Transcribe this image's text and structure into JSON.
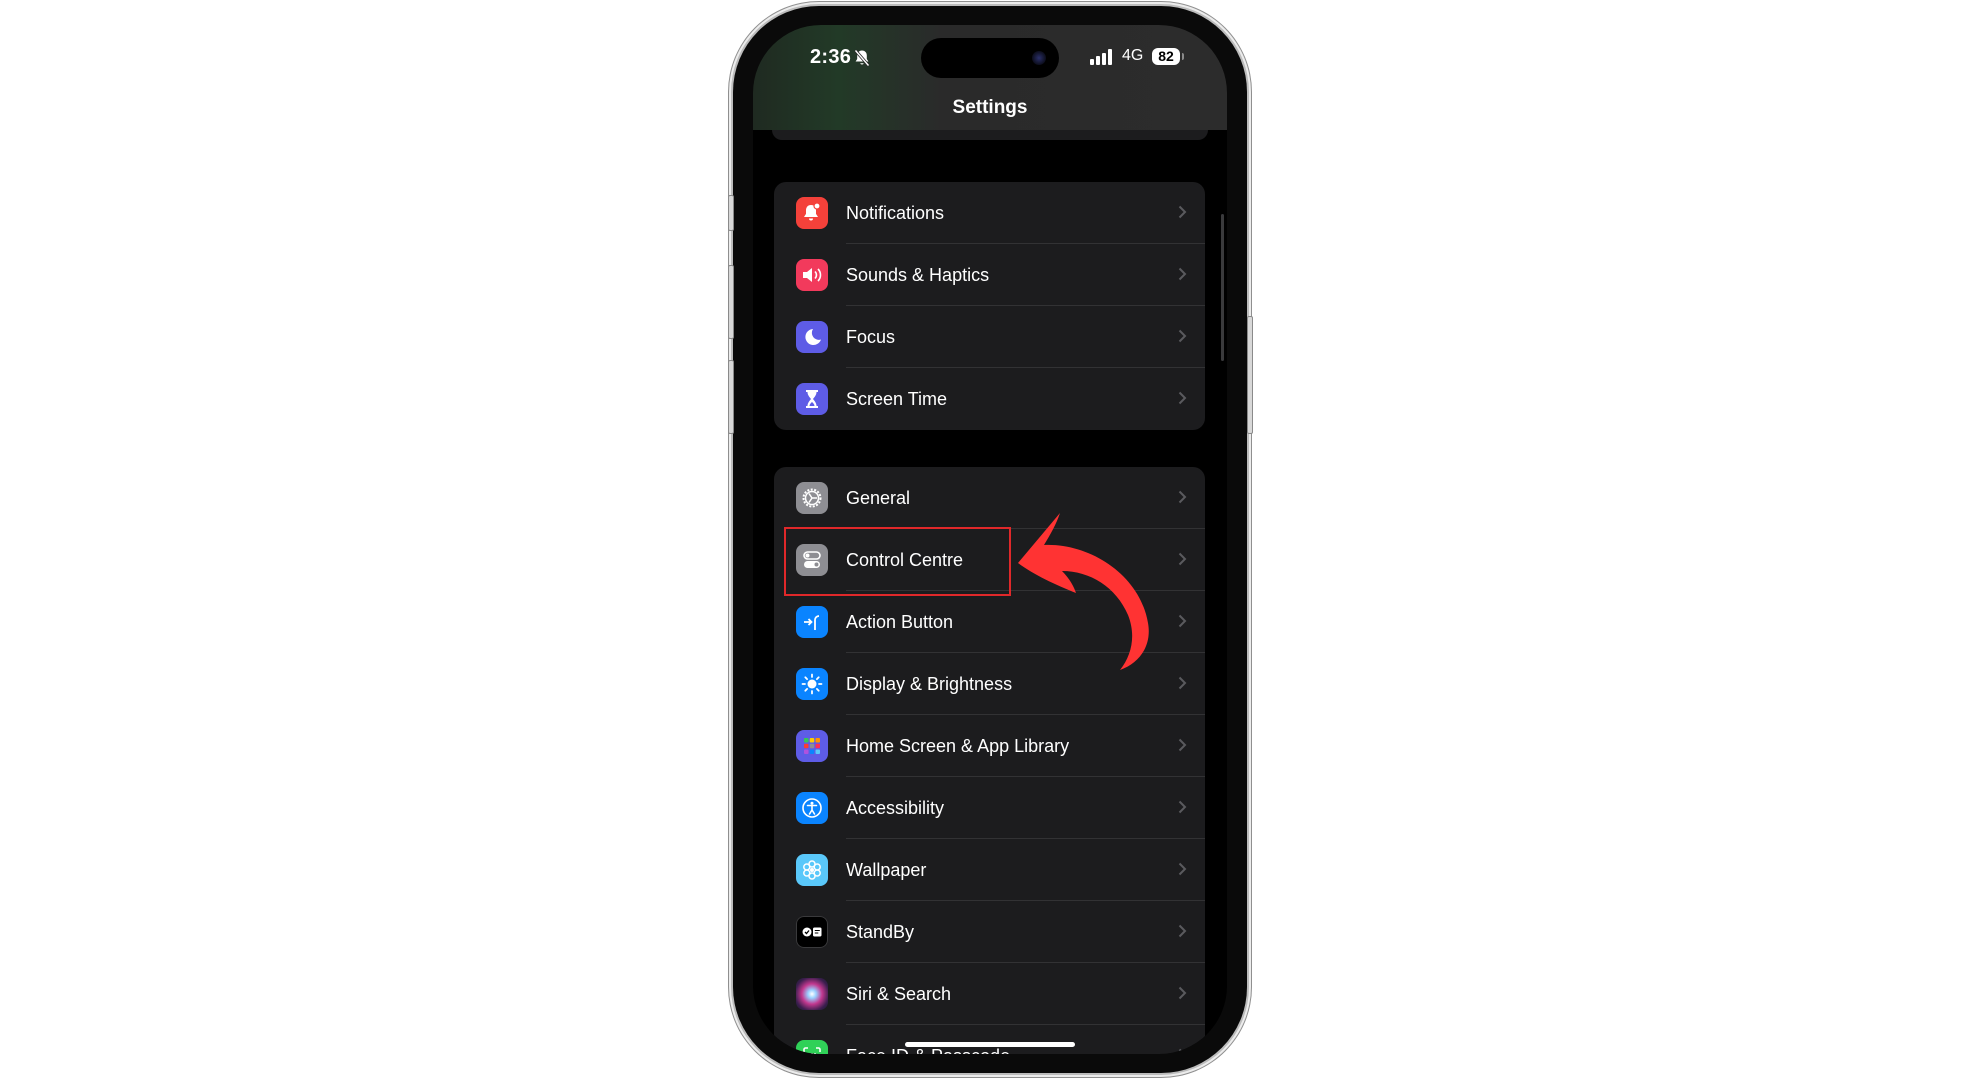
{
  "status_bar": {
    "time": "2:36",
    "mute_icon": "bell-slash-icon",
    "network": "4G",
    "battery": "82",
    "signal_icon": "cellular-signal-icon"
  },
  "header": {
    "title": "Settings"
  },
  "groups": [
    {
      "items": [
        {
          "label": "Notifications",
          "icon": "bell-badge-icon",
          "color": "#f4413a"
        },
        {
          "label": "Sounds & Haptics",
          "icon": "speaker-wave-icon",
          "color": "#f23a5c"
        },
        {
          "label": "Focus",
          "icon": "moon-icon",
          "color": "#5e5ce6"
        },
        {
          "label": "Screen Time",
          "icon": "hourglass-icon",
          "color": "#5e5ce6"
        }
      ]
    },
    {
      "items": [
        {
          "label": "General",
          "icon": "gear-icon",
          "color": "#8e8e93"
        },
        {
          "label": "Control Centre",
          "icon": "toggles-icon",
          "color": "#8e8e93"
        },
        {
          "label": "Action Button",
          "icon": "action-button-icon",
          "color": "#0a84ff"
        },
        {
          "label": "Display & Brightness",
          "icon": "sun-icon",
          "color": "#0a84ff"
        },
        {
          "label": "Home Screen & App Library",
          "icon": "app-grid-icon",
          "color": "#5e5ce6"
        },
        {
          "label": "Accessibility",
          "icon": "accessibility-icon",
          "color": "#0a84ff"
        },
        {
          "label": "Wallpaper",
          "icon": "flower-icon",
          "color": "#5ac8fa"
        },
        {
          "label": "StandBy",
          "icon": "standby-icon",
          "color": "#000000"
        },
        {
          "label": "Siri & Search",
          "icon": "siri-icon",
          "color": "#1c1c1e"
        },
        {
          "label": "Face ID & Passcode",
          "icon": "face-id-icon",
          "color": "#30d158"
        }
      ]
    }
  ],
  "annotation": {
    "highlighted_item": "Control Centre",
    "highlight_color": "#e0282a",
    "arrow_color": "#ff3333"
  }
}
